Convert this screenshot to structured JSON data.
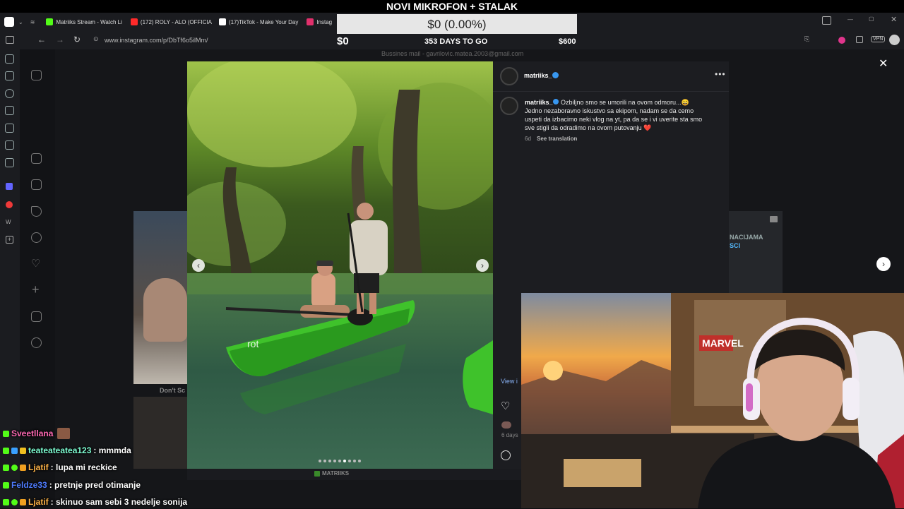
{
  "stream": {
    "title": "NOVI MIKROFON + STALAK",
    "goal_amount": "$0 (0.00%)",
    "goal_start": "$0",
    "goal_days": "353 DAYS TO GO",
    "goal_end": "$600",
    "business_mail": "Bussines mail - gavrilovic.matea.2003@gmail.com"
  },
  "browser": {
    "tabs": [
      {
        "label": "Matriiks Stream - Watch Li",
        "color": "#53fc18"
      },
      {
        "label": "(172) ROLY - ALO (OFFICIA",
        "color": "#ff2a2a"
      },
      {
        "label": "(17)TikTok - Make Your Day",
        "color": "#ffffff"
      },
      {
        "label": "Instag",
        "color": "#e1306c"
      }
    ],
    "url": "www.instagram.com/p/DbTf6o5ilMm/"
  },
  "post": {
    "username": "matriiks_",
    "caption_lines": [
      "Ozbiljno smo se umorili na ovom odmoru...😄",
      "Jedno nezaboravno iskustvo sa ekipom, nadam se da cemo",
      "uspeti da izbacimo neki vlog na yt, pa da se i vi uverite sta smo",
      "sve stigli da odradimo na ovom putovanju ❤️"
    ],
    "age": "6d",
    "see_translation": "See translation",
    "view_partial": "View i",
    "days_partial": "6 days"
  },
  "background_cards": {
    "left_label": "Don't Sc",
    "right_label_1": "NACIJAMA",
    "right_label_2": "SCI"
  },
  "bottom_strip": {
    "label": "MATRIIKS"
  },
  "chat": [
    {
      "user": "Sveetllana",
      "msg": "",
      "color": "#ff69b4"
    },
    {
      "user": "teateateatea123",
      "msg": ": mmmda",
      "color": "#7fffd4"
    },
    {
      "user": "Ljatif",
      "msg": ": lupa mi reckice",
      "color": "#ffb347"
    },
    {
      "user": "Feldze33",
      "msg": ": pretnje pred otimanje",
      "color": "#4f7cff"
    },
    {
      "user": "Ljatif",
      "msg": ": skinuo sam sebi 3 nedelje sonija",
      "color": "#ffb347"
    }
  ]
}
